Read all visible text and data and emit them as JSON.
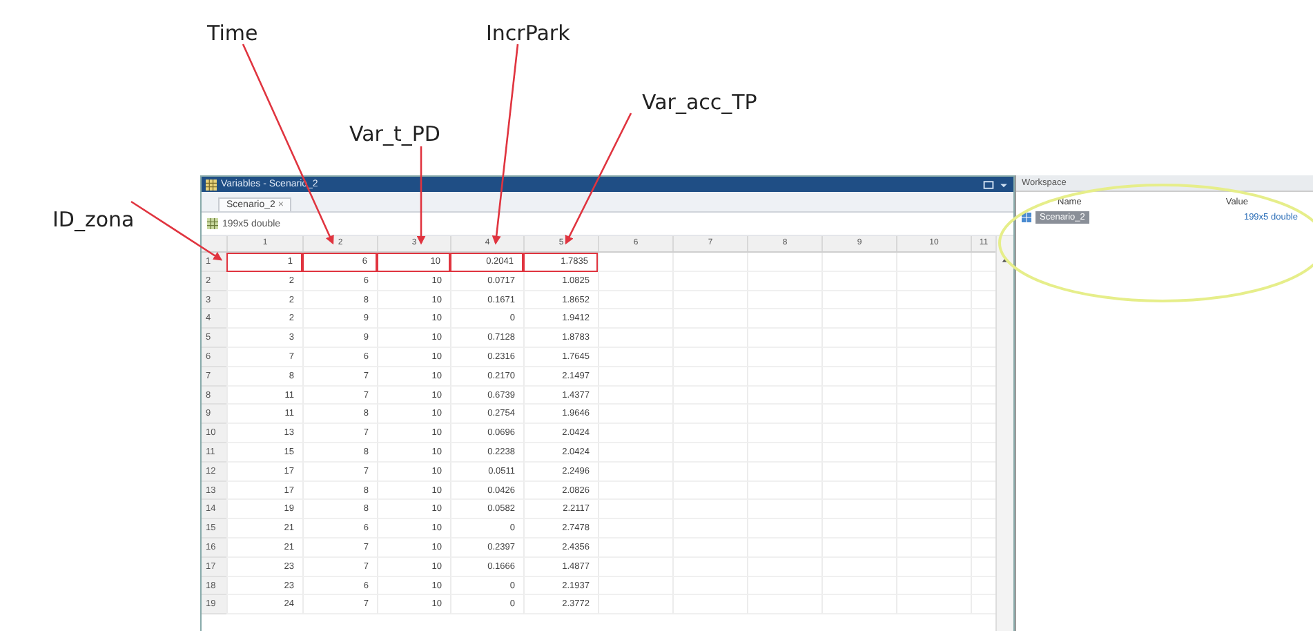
{
  "annotations": [
    {
      "text": "ID_zona"
    },
    {
      "text": "Time"
    },
    {
      "text": "Var_t_PD"
    },
    {
      "text": "IncrPark"
    },
    {
      "text": "Var_acc_TP"
    }
  ],
  "variables_window": {
    "title": "Variables - Scenario_2",
    "tab": {
      "label": "Scenario_2",
      "close": "×"
    },
    "variable_type": "199x5 double",
    "table": {
      "columns": [
        "1",
        "2",
        "3",
        "4",
        "5",
        "6",
        "7",
        "8",
        "9",
        "10",
        "11"
      ],
      "rows": [
        {
          "row": "1",
          "outlined": true,
          "cells": [
            "1",
            "6",
            "10",
            "0.2041",
            "1.7835"
          ]
        },
        {
          "row": "2",
          "outlined": false,
          "cells": [
            "2",
            "6",
            "10",
            "0.0717",
            "1.0825"
          ]
        },
        {
          "row": "3",
          "outlined": false,
          "cells": [
            "2",
            "8",
            "10",
            "0.1671",
            "1.8652"
          ]
        },
        {
          "row": "4",
          "outlined": false,
          "cells": [
            "2",
            "9",
            "10",
            "0",
            "1.9412"
          ]
        },
        {
          "row": "5",
          "outlined": false,
          "cells": [
            "3",
            "9",
            "10",
            "0.7128",
            "1.8783"
          ]
        },
        {
          "row": "6",
          "outlined": false,
          "cells": [
            "7",
            "6",
            "10",
            "0.2316",
            "1.7645"
          ]
        },
        {
          "row": "7",
          "outlined": false,
          "cells": [
            "8",
            "7",
            "10",
            "0.2170",
            "2.1497"
          ]
        },
        {
          "row": "8",
          "outlined": false,
          "cells": [
            "11",
            "7",
            "10",
            "0.6739",
            "1.4377"
          ]
        },
        {
          "row": "9",
          "outlined": false,
          "cells": [
            "11",
            "8",
            "10",
            "0.2754",
            "1.9646"
          ]
        },
        {
          "row": "10",
          "outlined": false,
          "cells": [
            "13",
            "7",
            "10",
            "0.0696",
            "2.0424"
          ]
        },
        {
          "row": "11",
          "outlined": false,
          "cells": [
            "15",
            "8",
            "10",
            "0.2238",
            "2.0424"
          ]
        },
        {
          "row": "12",
          "outlined": false,
          "cells": [
            "17",
            "7",
            "10",
            "0.0511",
            "2.2496"
          ]
        },
        {
          "row": "13",
          "outlined": false,
          "cells": [
            "17",
            "8",
            "10",
            "0.0426",
            "2.0826"
          ]
        },
        {
          "row": "14",
          "outlined": false,
          "cells": [
            "19",
            "8",
            "10",
            "0.0582",
            "2.2117"
          ]
        },
        {
          "row": "15",
          "outlined": false,
          "cells": [
            "21",
            "6",
            "10",
            "0",
            "2.7478"
          ]
        },
        {
          "row": "16",
          "outlined": false,
          "cells": [
            "21",
            "7",
            "10",
            "0.2397",
            "2.4356"
          ]
        },
        {
          "row": "17",
          "outlined": false,
          "cells": [
            "23",
            "7",
            "10",
            "0.1666",
            "1.4877"
          ]
        },
        {
          "row": "18",
          "outlined": false,
          "cells": [
            "23",
            "6",
            "10",
            "0",
            "2.1937"
          ]
        },
        {
          "row": "19",
          "outlined": false,
          "cells": [
            "24",
            "7",
            "10",
            "0",
            "2.3772"
          ]
        }
      ]
    }
  },
  "workspace": {
    "title": "Workspace",
    "columns": [
      "Name",
      "Value"
    ],
    "items": [
      {
        "name": "Scenario_2",
        "value": "199x5 double",
        "selected": true
      }
    ]
  }
}
